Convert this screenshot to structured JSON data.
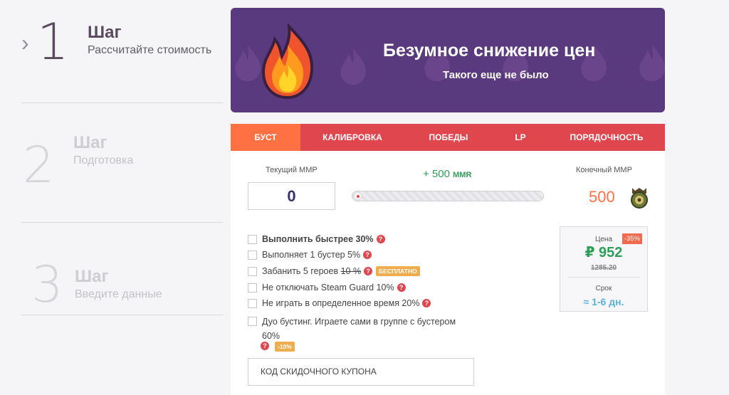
{
  "steps": [
    {
      "chevron": "›",
      "number": "1",
      "title": "Шаг",
      "subtitle": "Рассчитайте стоимость"
    },
    {
      "number": "2",
      "title": "Шаг",
      "subtitle": "Подготовка"
    },
    {
      "number": "3",
      "title": "Шаг",
      "subtitle": "Введите данные"
    }
  ],
  "banner": {
    "title": "Безумное снижение цен",
    "subtitle": "Такого еще не было",
    "icon": "fire-icon",
    "bg_color": "#5a3a7e"
  },
  "tabs": [
    {
      "label": "БУСТ",
      "active": true
    },
    {
      "label": "КАЛИБРОВКА",
      "active": false
    },
    {
      "label": "ПОБЕДЫ",
      "active": false
    },
    {
      "label": "LP",
      "active": false
    },
    {
      "label": "ПОРЯДОЧНОСТЬ",
      "active": false
    }
  ],
  "calculator": {
    "current_label": "Текущий ММР",
    "current_value": "0",
    "increment": "+ 500",
    "increment_unit": "MMR",
    "final_label": "Конечный ММР",
    "final_value": "500",
    "slider_level": 0
  },
  "options": [
    {
      "label": "Выполнить быстрее 30%",
      "bold": true
    },
    {
      "label": "Выполняет 1 бустер 5%"
    },
    {
      "label": "Забанить 5 героев ",
      "strike": "10 %",
      "badge": "БЕСПЛАТНО"
    },
    {
      "label": "Не отключать Steam Guard 10%"
    },
    {
      "label": "Не играть в определенное время 20%"
    },
    {
      "label": "Дуо бустинг. Играете сами в группе с бустером 60%",
      "badge": "-10%"
    }
  ],
  "help_glyph": "?",
  "coupon": {
    "placeholder": "КОД СКИДОЧНОГО КУПОНА"
  },
  "price": {
    "label": "Цена",
    "discount": "-35%",
    "value": "₽ 952",
    "old": "1285.20",
    "term_label": "Срок",
    "term": "≈ 1-6 дн."
  },
  "colors": {
    "tab_bar": "#e0464d",
    "tab_active": "#ff7043",
    "price": "#2f9e58",
    "term": "#5ab0d8"
  }
}
